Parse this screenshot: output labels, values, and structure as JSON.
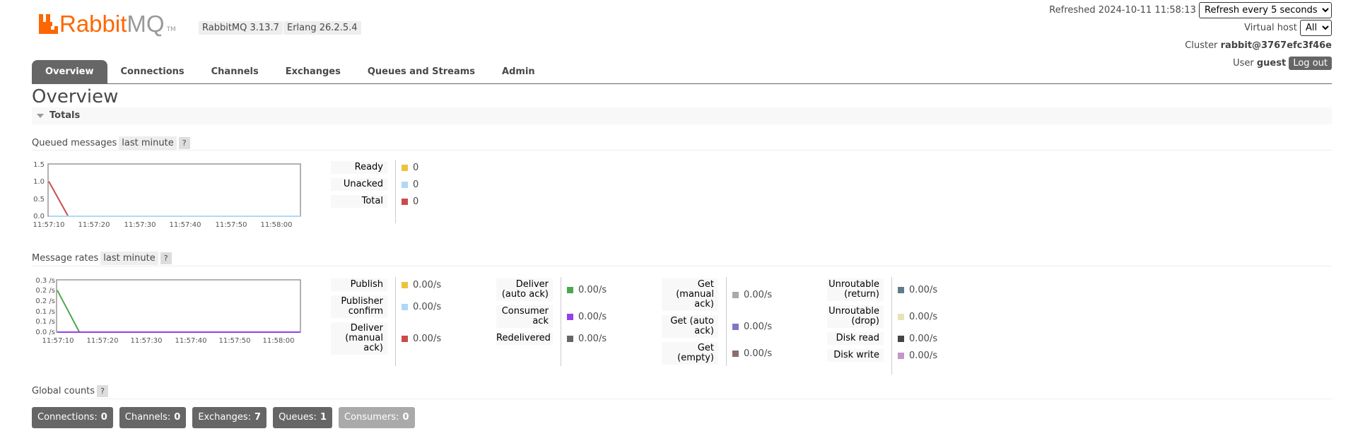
{
  "header": {
    "logo_r": "Rabbit",
    "logo_mq": "MQ",
    "logo_tm": "TM",
    "version": "RabbitMQ 3.13.7",
    "erlang": "Erlang 26.2.5.4",
    "refreshed_label": "Refreshed",
    "refreshed_time": "2024-10-11 11:58:13",
    "refresh_select": "Refresh every 5 seconds",
    "vhost_label": "Virtual host",
    "vhost_select": "All",
    "cluster_label": "Cluster",
    "cluster_value": "rabbit@3767efc3f46e",
    "user_label": "User",
    "user_value": "guest",
    "logout_label": "Log out"
  },
  "tabs": [
    "Overview",
    "Connections",
    "Channels",
    "Exchanges",
    "Queues and Streams",
    "Admin"
  ],
  "page_title": "Overview",
  "totals_label": "Totals",
  "queued": {
    "title": "Queued messages",
    "range": "last minute",
    "help": "?",
    "legend": [
      {
        "label": "Ready",
        "value": "0",
        "color": "#edc240"
      },
      {
        "label": "Unacked",
        "value": "0",
        "color": "#afd8f8"
      },
      {
        "label": "Total",
        "value": "0",
        "color": "#cb4b4b"
      }
    ]
  },
  "rates": {
    "title": "Message rates",
    "range": "last minute",
    "help": "?",
    "groups": [
      [
        {
          "label": "Publish",
          "value": "0.00/s",
          "color": "#edc240"
        },
        {
          "label": "Publisher confirm",
          "value": "0.00/s",
          "color": "#afd8f8"
        },
        {
          "label": "Deliver (manual ack)",
          "value": "0.00/s",
          "color": "#cb4b4b"
        }
      ],
      [
        {
          "label": "Deliver (auto ack)",
          "value": "0.00/s",
          "color": "#4da74d"
        },
        {
          "label": "Consumer ack",
          "value": "0.00/s",
          "color": "#9440ed"
        },
        {
          "label": "Redelivered",
          "value": "0.00/s",
          "color": "#666666"
        }
      ],
      [
        {
          "label": "Get (manual ack)",
          "value": "0.00/s",
          "color": "#aaaaaa"
        },
        {
          "label": "Get (auto ack)",
          "value": "0.00/s",
          "color": "#7c79c3"
        },
        {
          "label": "Get (empty)",
          "value": "0.00/s",
          "color": "#8d6e6e"
        }
      ],
      [
        {
          "label": "Unroutable (return)",
          "value": "0.00/s",
          "color": "#607b8b"
        },
        {
          "label": "Unroutable (drop)",
          "value": "0.00/s",
          "color": "#e8e2b5"
        },
        {
          "label": "Disk read",
          "value": "0.00/s",
          "color": "#444444"
        },
        {
          "label": "Disk write",
          "value": "0.00/s",
          "color": "#c497c4"
        }
      ]
    ]
  },
  "global": {
    "title": "Global counts",
    "help": "?",
    "counts": [
      {
        "label": "Connections:",
        "value": "0",
        "dim": false
      },
      {
        "label": "Channels:",
        "value": "0",
        "dim": false
      },
      {
        "label": "Exchanges:",
        "value": "7",
        "dim": false
      },
      {
        "label": "Queues:",
        "value": "1",
        "dim": false
      },
      {
        "label": "Consumers:",
        "value": "0",
        "dim": true
      }
    ]
  },
  "chart_data": [
    {
      "type": "line",
      "name": "queued-messages",
      "x": [
        "11:57:10",
        "11:57:20",
        "11:57:30",
        "11:57:40",
        "11:57:50",
        "11:58:00"
      ],
      "y_ticks": [
        "0.0",
        "0.5",
        "1.0",
        "1.5"
      ],
      "ylim": [
        0,
        1.5
      ],
      "xlim_seconds": [
        0,
        65
      ],
      "series": [
        {
          "name": "Total",
          "color": "#cb4b4b",
          "points": [
            [
              0,
              1.0
            ],
            [
              5,
              0
            ],
            [
              65,
              0
            ]
          ]
        },
        {
          "name": "Unacked",
          "color": "#afd8f8",
          "points": [
            [
              0,
              0
            ],
            [
              65,
              0
            ]
          ]
        }
      ]
    },
    {
      "type": "line",
      "name": "message-rates",
      "x": [
        "11:57:10",
        "11:57:20",
        "11:57:30",
        "11:57:40",
        "11:57:50",
        "11:58:00"
      ],
      "y_ticks": [
        "0.0 /s",
        "0.1 /s",
        "0.1 /s",
        "0.2 /s",
        "0.2 /s",
        "0.3 /s"
      ],
      "ylim": [
        0,
        0.25
      ],
      "xlim_seconds": [
        0,
        55
      ],
      "series": [
        {
          "name": "Deliver (auto ack)",
          "color": "#4da74d",
          "points": [
            [
              0,
              0.2
            ],
            [
              5,
              0
            ],
            [
              55,
              0
            ]
          ]
        },
        {
          "name": "Consumer ack",
          "color": "#9440ed",
          "points": [
            [
              0,
              0
            ],
            [
              55,
              0
            ]
          ]
        }
      ]
    }
  ]
}
